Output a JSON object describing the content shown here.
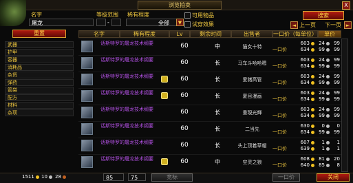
{
  "title": "浏览拍卖",
  "close_label": "X",
  "search": {
    "name_label": "名字",
    "name_value": "屠龙",
    "level_label": "等级范围",
    "level_sep": "-",
    "rarity_label": "稀有程度",
    "rarity_value": "全部",
    "usable_label": "可用物品",
    "display_label": "试穿效果",
    "search_button": "搜索",
    "prev_label": "上一页",
    "next_label": "下一页"
  },
  "sidebar": {
    "reset_button": "重置",
    "items": [
      {
        "label": "武器"
      },
      {
        "label": "护甲"
      },
      {
        "label": "容器"
      },
      {
        "label": "消耗品"
      },
      {
        "label": "杂货"
      },
      {
        "label": "弹药"
      },
      {
        "label": "箭袋"
      },
      {
        "label": "配方"
      },
      {
        "label": "材料"
      },
      {
        "label": "杂项"
      }
    ]
  },
  "columns": {
    "name": "名字",
    "rarity": "稀有程度",
    "lv": "Lv",
    "time": "剩余时间",
    "seller": "出售者",
    "price": "一口价（每单位）",
    "unit": "单价"
  },
  "rows": [
    {
      "name": "话斯特罗的屠龙技术纲要",
      "lv": "60",
      "time": "中",
      "seller": "猫女十特",
      "bo_label": "一口价",
      "gold": "603",
      "silver": "24",
      "copper": "99",
      "b_gold": "634",
      "b_silver": "99",
      "b_copper": "99",
      "star": false
    },
    {
      "name": "话斯特罗的屠龙技术纲要",
      "lv": "60",
      "time": "长",
      "seller": "马车斗哈哈嗯",
      "bo_label": "一口价",
      "gold": "603",
      "silver": "24",
      "copper": "99",
      "b_gold": "634",
      "b_silver": "99",
      "b_copper": "99",
      "star": false
    },
    {
      "name": "话斯特罗的屠龙技术纲要",
      "lv": "60",
      "time": "长",
      "seller": "爱猪高管",
      "bo_label": "一口价",
      "gold": "603",
      "silver": "24",
      "copper": "99",
      "b_gold": "634",
      "b_silver": "99",
      "b_copper": "99",
      "star": true
    },
    {
      "name": "话斯特罗的屠龙技术纲要",
      "lv": "60",
      "time": "长",
      "seller": "夏目漫画",
      "bo_label": "一口价",
      "gold": "603",
      "silver": "24",
      "copper": "99",
      "b_gold": "634",
      "b_silver": "99",
      "b_copper": "99",
      "star": true
    },
    {
      "name": "话斯特罗的屠龙技术纲要",
      "lv": "60",
      "time": "长",
      "seller": "重現光輝",
      "bo_label": "一口价",
      "gold": "603",
      "silver": "24",
      "copper": "99",
      "b_gold": "634",
      "b_silver": "99",
      "b_copper": "99",
      "star": false
    },
    {
      "name": "话斯特罗的屠龙技术纲要",
      "lv": "60",
      "time": "长",
      "seller": "二当先",
      "bo_label": "一口价",
      "gold": "630",
      "silver": "0",
      "copper": "0",
      "b_gold": "634",
      "b_silver": "99",
      "b_copper": "99",
      "star": false
    },
    {
      "name": "话斯特罗的屠龙技术纲要",
      "lv": "60",
      "time": "长",
      "seller": "头上顶着草帽",
      "bo_label": "一口价",
      "gold": "607",
      "silver": "1",
      "copper": "1",
      "b_gold": "639",
      "b_silver": "1",
      "b_copper": "1",
      "star": false
    },
    {
      "name": "话斯特罗的屠龙技术纲要",
      "lv": "60",
      "time": "中",
      "seller": "空灵之狼",
      "bo_label": "一口价",
      "gold": "608",
      "silver": "81",
      "copper": "20",
      "b_gold": "640",
      "b_silver": "85",
      "b_copper": "8",
      "star": true
    }
  ],
  "footer": {
    "money_gold": "1511",
    "money_silver": "10",
    "money_copper": "28",
    "deposit_left": "85",
    "deposit_right": "75",
    "bid_button": "竞标",
    "buyout_button": "一口价",
    "close_button": "关闭"
  }
}
